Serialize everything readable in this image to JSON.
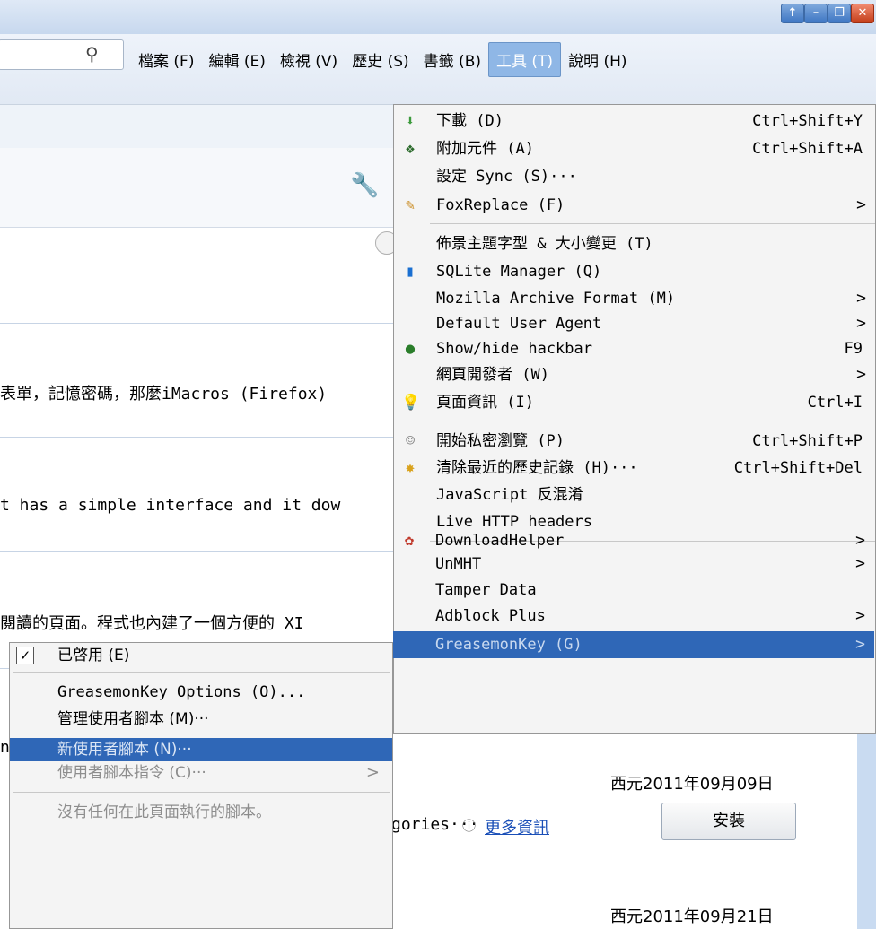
{
  "window": {
    "buttons": [
      "↑",
      "–",
      "❐",
      "✕"
    ]
  },
  "menubar": [
    "檔案 (F)",
    "編輯 (E)",
    "檢視 (V)",
    "歷史 (S)",
    "書籤 (B)",
    "工具 (T)",
    "說明 (H)"
  ],
  "content": {
    "desc1": "表單，記憶密碼，那麼iMacros (Firefox)",
    "desc2": "t has a simple interface and it dow",
    "desc3": "閱讀的頁面。程式也內建了一個方便的 XI",
    "fragment": "n",
    "categories": "gories···",
    "more_info": "更多資訊",
    "install": "安裝",
    "date1": "西元2011年09月09日",
    "date2": "西元2011年09月21日"
  },
  "tools_menu": [
    {
      "icon": "download-icon",
      "label": "下載 (D)",
      "shortcut": "Ctrl+Shift+Y"
    },
    {
      "icon": "addon-icon",
      "label": "附加元件 (A)",
      "shortcut": "Ctrl+Shift+A"
    },
    {
      "icon": "",
      "label": "設定 Sync (S)···",
      "shortcut": ""
    },
    {
      "icon": "foxreplace-icon",
      "label": "FoxReplace (F)",
      "shortcut": "",
      "submenu": true
    },
    {
      "icon": "",
      "label": "佈景主題字型 & 大小變更 (T)",
      "shortcut": ""
    },
    {
      "icon": "sqlite-icon",
      "label": "SQLite Manager (Q)",
      "shortcut": ""
    },
    {
      "icon": "",
      "label": "Mozilla Archive Format (M)",
      "shortcut": "",
      "submenu": true
    },
    {
      "icon": "",
      "label": "Default User Agent",
      "shortcut": "",
      "submenu": true
    },
    {
      "icon": "hackbar-icon",
      "label": "Show/hide hackbar",
      "shortcut": "F9"
    },
    {
      "icon": "",
      "label": "網頁開發者 (W)",
      "shortcut": "",
      "submenu": true
    },
    {
      "icon": "pageinfo-icon",
      "label": "頁面資訊 (I)",
      "shortcut": "Ctrl+I"
    },
    {
      "icon": "private-icon",
      "label": "開始私密瀏覽 (P)",
      "shortcut": "Ctrl+Shift+P"
    },
    {
      "icon": "broom-icon",
      "label": "清除最近的歷史記錄 (H)···",
      "shortcut": "Ctrl+Shift+Del"
    },
    {
      "icon": "",
      "label": "JavaScript 反混淆",
      "shortcut": ""
    },
    {
      "icon": "",
      "label": "Live HTTP headers",
      "shortcut": ""
    },
    {
      "icon": "downloadhelper-icon",
      "label": "DownloadHelper",
      "shortcut": "",
      "submenu": true
    },
    {
      "icon": "",
      "label": "UnMHT",
      "shortcut": "",
      "submenu": true
    },
    {
      "icon": "",
      "label": "Tamper Data",
      "shortcut": ""
    },
    {
      "icon": "",
      "label": "Adblock Plus",
      "shortcut": "",
      "submenu": true
    },
    {
      "icon": "",
      "label": "GreasemonKey (G)",
      "shortcut": "",
      "submenu": true
    }
  ],
  "gm_menu": {
    "enabled": "已啓用 (E)",
    "options": "GreasemonKey Options (O)...",
    "manage": "管理使用者腳本 (M)···",
    "new_script": "新使用者腳本 (N)···",
    "commands": "使用者腳本指令 (C)···",
    "none": "沒有任何在此頁面執行的腳本。"
  }
}
